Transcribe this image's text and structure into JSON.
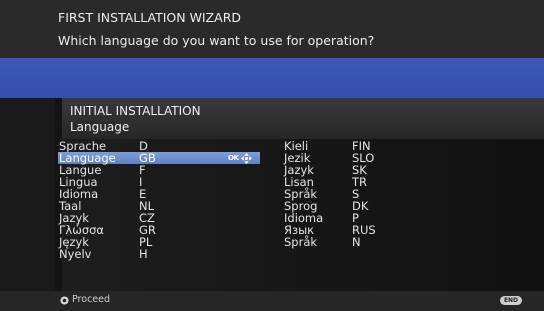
{
  "wizard": {
    "title": "FIRST INSTALLATION WIZARD",
    "question": "Which language do you want to use for operation?"
  },
  "panel": {
    "title": "INITIAL INSTALLATION",
    "subtitle": "Language"
  },
  "languages_left": [
    {
      "name": "Sprache",
      "code": "D"
    },
    {
      "name": "Language",
      "code": "GB",
      "selected": true
    },
    {
      "name": "Langue",
      "code": "F"
    },
    {
      "name": "Lingua",
      "code": "I"
    },
    {
      "name": "Idioma",
      "code": "E"
    },
    {
      "name": "Taal",
      "code": "NL"
    },
    {
      "name": "Jazyk",
      "code": "CZ"
    },
    {
      "name": "Γλώσσα",
      "code": "GR"
    },
    {
      "name": "Język",
      "code": "PL"
    },
    {
      "name": "Nyelv",
      "code": "H"
    }
  ],
  "languages_right": [
    {
      "name": "Kieli",
      "code": "FIN"
    },
    {
      "name": "Jezik",
      "code": "SLO"
    },
    {
      "name": "Jazyk",
      "code": "SK"
    },
    {
      "name": "Lisan",
      "code": "TR"
    },
    {
      "name": "Språk",
      "code": "S"
    },
    {
      "name": "Sprog",
      "code": "DK"
    },
    {
      "name": "Idioma",
      "code": "P"
    },
    {
      "name": "Язык",
      "code": "RUS"
    },
    {
      "name": "Språk",
      "code": "N"
    }
  ],
  "ok_hint": {
    "label": "OK",
    "icon": "navigation-arrows-icon"
  },
  "footer": {
    "proceed_label": "Proceed",
    "proceed_icon": "ok-circle-icon",
    "end_label": "END"
  },
  "colors": {
    "accent_band": "#3e57b4",
    "selection": "#6f8fd0"
  }
}
